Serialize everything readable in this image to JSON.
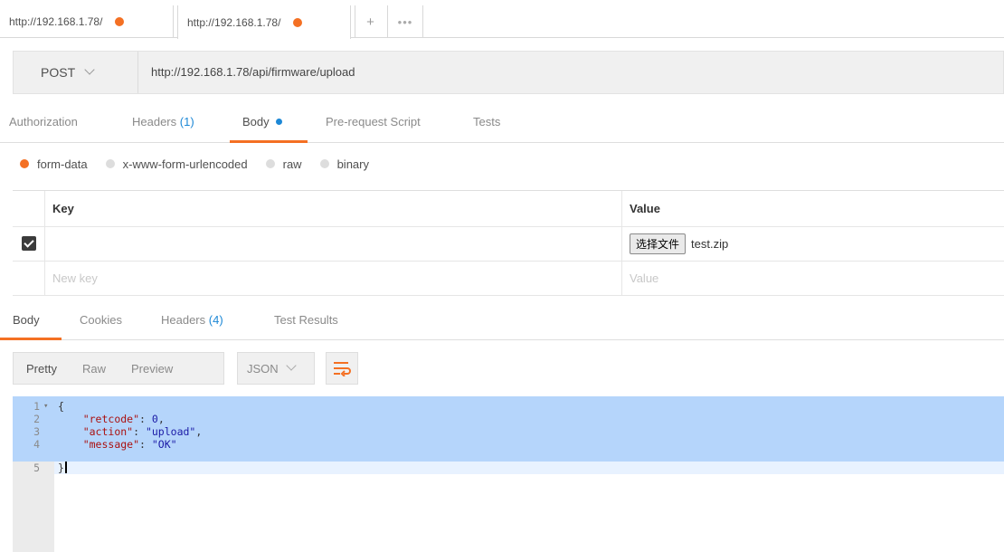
{
  "tabs": [
    {
      "label": "http://192.168.1.78/"
    },
    {
      "label": "http://192.168.1.78/"
    }
  ],
  "tab_actions": {
    "add": "+",
    "more": "•••"
  },
  "request": {
    "method": "POST",
    "url": "http://192.168.1.78/api/firmware/upload"
  },
  "request_tabs": {
    "authorization": "Authorization",
    "headers": "Headers",
    "headers_count": "(1)",
    "body": "Body",
    "pre_request": "Pre-request Script",
    "tests": "Tests"
  },
  "body_types": {
    "form_data": "form-data",
    "urlencoded": "x-www-form-urlencoded",
    "raw": "raw",
    "binary": "binary",
    "selected": "form-data"
  },
  "params_table": {
    "key_header": "Key",
    "value_header": "Value",
    "row": {
      "file_button": "选择文件",
      "file_name": "test.zip"
    },
    "new_key_placeholder": "New key",
    "new_value_placeholder": "Value"
  },
  "response_tabs": {
    "body": "Body",
    "cookies": "Cookies",
    "headers": "Headers",
    "headers_count": "(4)",
    "test_results": "Test Results"
  },
  "response_view": {
    "pretty": "Pretty",
    "raw": "Raw",
    "preview": "Preview",
    "format": "JSON"
  },
  "response_code": {
    "line_numbers": [
      "1",
      "2",
      "3",
      "4",
      "5"
    ],
    "open_brace": "{",
    "retcode_key": "\"retcode\"",
    "retcode_value": "0",
    "action_key": "\"action\"",
    "action_value": "\"upload\"",
    "message_key": "\"message\"",
    "message_value": "\"OK\"",
    "close_brace": "}"
  },
  "colors": {
    "accent": "#f47023",
    "link_blue": "#1d88d6",
    "selection": "#b5d5fb"
  }
}
